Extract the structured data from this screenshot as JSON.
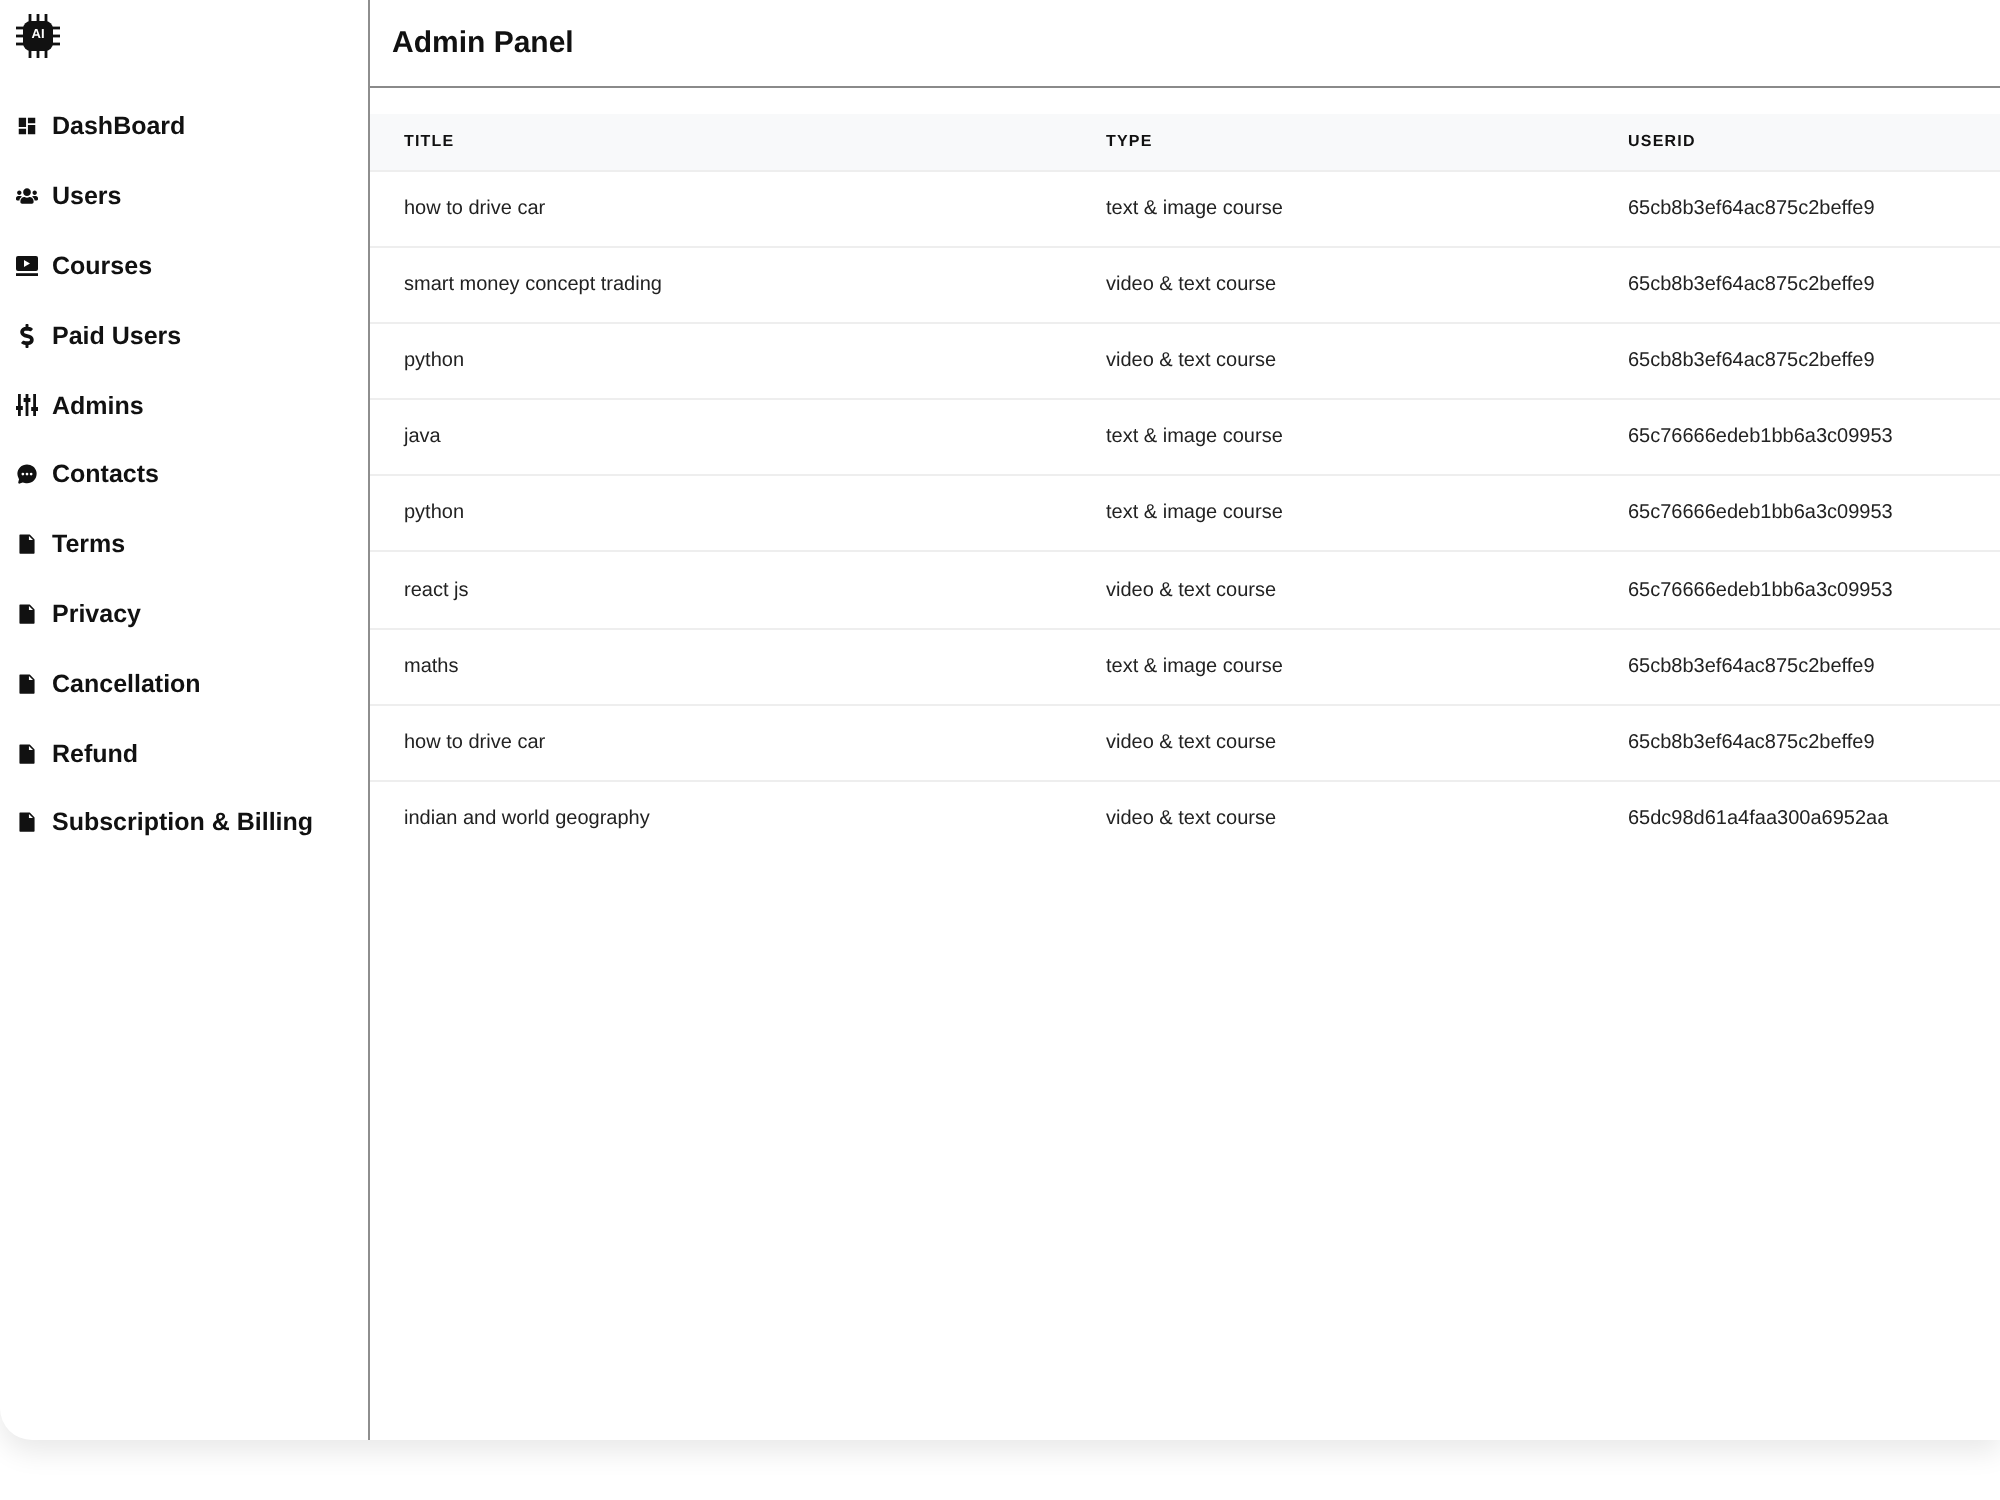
{
  "app": {
    "logo_text": "AI"
  },
  "sidebar": {
    "items": [
      {
        "label": "DashBoard",
        "kind": "dashboard"
      },
      {
        "label": "Users",
        "kind": "users"
      },
      {
        "label": "Courses",
        "kind": "courses"
      },
      {
        "label": "Paid Users",
        "kind": "payments"
      },
      {
        "label": "Admins",
        "kind": "admins"
      },
      {
        "label": "Contacts",
        "kind": "contacts"
      },
      {
        "label": "Terms",
        "kind": "page"
      },
      {
        "label": "Privacy",
        "kind": "page"
      },
      {
        "label": "Cancellation",
        "kind": "page"
      },
      {
        "label": "Refund",
        "kind": "page"
      },
      {
        "label": "Subscription & Billing",
        "kind": "page"
      }
    ]
  },
  "header": {
    "title": "Admin Panel"
  },
  "table": {
    "columns": [
      "TITLE",
      "TYPE",
      "USERID"
    ],
    "rows": [
      [
        "how to drive car",
        "text & image course",
        "65cb8b3ef64ac875c2beffe9"
      ],
      [
        "smart money concept trading",
        "video & text course",
        "65cb8b3ef64ac875c2beffe9"
      ],
      [
        "python",
        "video & text course",
        "65cb8b3ef64ac875c2beffe9"
      ],
      [
        "java",
        "text & image course",
        "65c76666edeb1bb6a3c09953"
      ],
      [
        "python",
        "text & image course",
        "65c76666edeb1bb6a3c09953"
      ],
      [
        "react js",
        "video & text course",
        "65c76666edeb1bb6a3c09953"
      ],
      [
        "maths",
        "text & image course",
        "65cb8b3ef64ac875c2beffe9"
      ],
      [
        "how to drive car",
        "video & text course",
        "65cb8b3ef64ac875c2beffe9"
      ],
      [
        "indian and world geography",
        "video & text course",
        "65dc98d61a4faa300a6952aa"
      ]
    ]
  }
}
